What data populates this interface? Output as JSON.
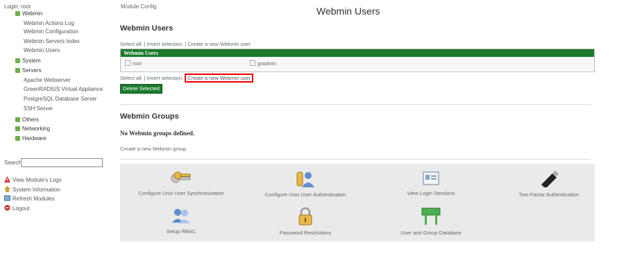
{
  "sidebar": {
    "login": "Login: root",
    "webmin": "Webmin",
    "webmin_items": [
      "Webmin Actions Log",
      "Webmin Configuration",
      "Webmin Servers Index",
      "Webmin Users"
    ],
    "system": "System",
    "servers": "Servers",
    "servers_items": [
      "Apache Webserver",
      "GreenRADIUS Virtual Appliance",
      "PostgreSQL Database Server",
      "SSH Server"
    ],
    "others": "Others",
    "networking": "Networking",
    "hardware": "Hardware",
    "search_label": "Search:",
    "search_value": "",
    "view_logs": "View Module's Logs",
    "system_info": "System Information",
    "refresh": "Refresh Modules",
    "logout": "Logout"
  },
  "header": {
    "module_config": "Module Config",
    "title": "Webmin Users"
  },
  "users": {
    "heading": "Webmin Users",
    "select_all": "Select all.",
    "invert": "Invert selection.",
    "create": "Create a new Webmin user",
    "separator": "|",
    "table_header": "Webmin Users",
    "rows": [
      "root",
      "gradmin"
    ],
    "delete_button": "Delete Selected"
  },
  "groups": {
    "heading": "Webmin Groups",
    "none": "No Webmin groups defined.",
    "create": "Create a new Webmin group."
  },
  "panel": {
    "tiles": [
      {
        "label": "Configure Unix User Synchronization",
        "icon": "keys-icon"
      },
      {
        "label": "Configure Unix User Authentication",
        "icon": "user-key-icon"
      },
      {
        "label": "View Login Sessions",
        "icon": "id-card-icon"
      },
      {
        "label": "Two-Factor Authentication",
        "icon": "usb-key-icon"
      },
      {
        "label": "Setup RBAC",
        "icon": "users-group-icon"
      },
      {
        "label": "Password Restrictions",
        "icon": "padlock-icon"
      },
      {
        "label": "User and Group Database",
        "icon": "database-sign-icon"
      }
    ]
  },
  "colors": {
    "table_header": "#1c7a2c",
    "highlight": "#ee0000",
    "panel_bg": "#eaeaea",
    "category_square": "#6ab04c"
  }
}
